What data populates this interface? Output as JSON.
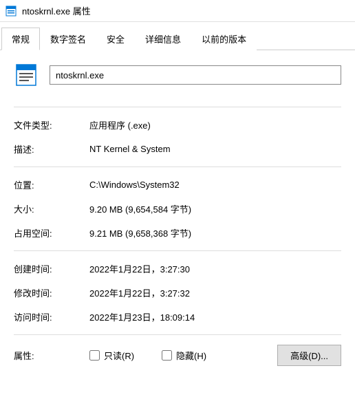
{
  "titlebar": {
    "title": "ntoskrnl.exe 属性"
  },
  "tabs": [
    {
      "label": "常规",
      "active": true
    },
    {
      "label": "数字签名",
      "active": false
    },
    {
      "label": "安全",
      "active": false
    },
    {
      "label": "详细信息",
      "active": false
    },
    {
      "label": "以前的版本",
      "active": false
    }
  ],
  "filename": "ntoskrnl.exe",
  "properties": {
    "filetype": {
      "label": "文件类型:",
      "value": "应用程序 (.exe)"
    },
    "description": {
      "label": "描述:",
      "value": "NT Kernel & System"
    },
    "location": {
      "label": "位置:",
      "value": "C:\\Windows\\System32"
    },
    "size": {
      "label": "大小:",
      "value": "9.20 MB (9,654,584 字节)"
    },
    "sizeondisk": {
      "label": "占用空间:",
      "value": "9.21 MB (9,658,368 字节)"
    },
    "created": {
      "label": "创建时间:",
      "value": "2022年1月22日，3:27:30"
    },
    "modified": {
      "label": "修改时间:",
      "value": "2022年1月22日，3:27:32"
    },
    "accessed": {
      "label": "访问时间:",
      "value": "2022年1月23日，18:09:14"
    }
  },
  "attributes": {
    "label": "属性:",
    "readonly": "只读(R)",
    "hidden": "隐藏(H)",
    "advanced": "高级(D)..."
  }
}
